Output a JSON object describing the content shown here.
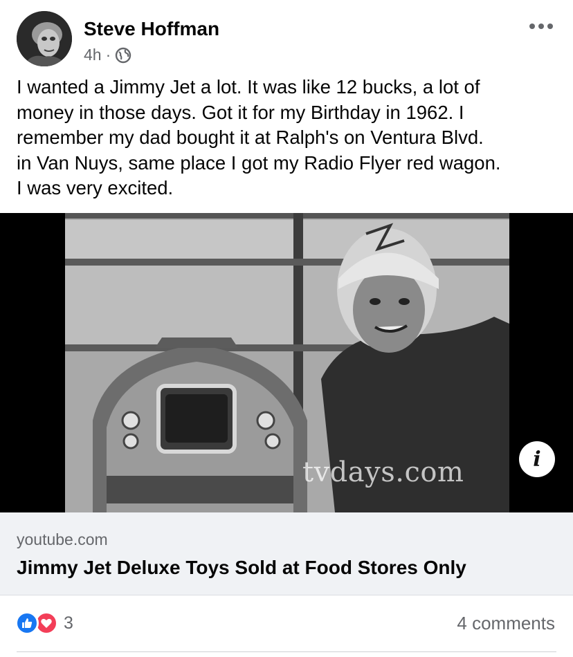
{
  "post": {
    "author": "Steve Hoffman",
    "time": "4h",
    "separator": "·",
    "audience_icon": "globe-icon",
    "more_icon": "more-horizontal-icon",
    "text": "I wanted a Jimmy Jet a lot.  It was like 12 bucks, a lot of\nmoney in those days.  Got it for my Birthday in 1962.  I\nremember my dad bought it at Ralph's on Ventura Blvd.\nin Van Nuys, same place I got my Radio Flyer red wagon.\nI was very excited."
  },
  "media": {
    "watermark": "tvdays.com",
    "info_icon": "info-icon",
    "info_glyph": "i"
  },
  "link": {
    "domain": "youtube.com",
    "title": "Jimmy Jet Deluxe Toys Sold at Food Stores Only"
  },
  "footer": {
    "reaction_icons": [
      "like-icon",
      "love-icon"
    ],
    "reaction_count": "3",
    "comments": "4 comments"
  },
  "colors": {
    "text_primary": "#050505",
    "text_secondary": "#65676b",
    "like_blue": "#1877f2",
    "love_red": "#f33e58",
    "card_bg": "#f0f2f5"
  }
}
